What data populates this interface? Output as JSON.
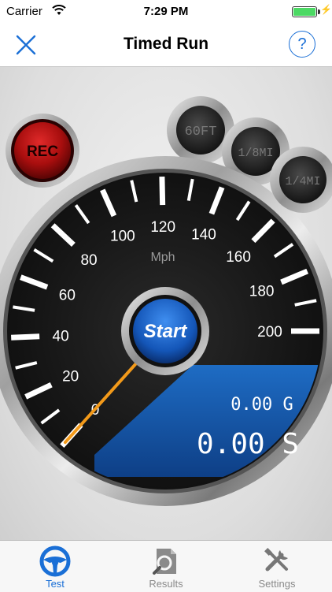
{
  "status": {
    "carrier": "Carrier",
    "time": "7:29 PM"
  },
  "nav": {
    "title": "Timed Run",
    "help": "?"
  },
  "gauge": {
    "unit": "Mph",
    "ticks": [
      "0",
      "20",
      "40",
      "60",
      "80",
      "100",
      "120",
      "140",
      "160",
      "180",
      "200"
    ],
    "needle_mph": 0,
    "start_label": "Start",
    "g_value": "0.00 G",
    "time_value": "0.00 S"
  },
  "buttons": {
    "rec": "REC",
    "b60ft": "60FT",
    "b18mi": "1/8MI",
    "b14mi": "1/4MI"
  },
  "tabs": [
    {
      "label": "Test",
      "active": true
    },
    {
      "label": "Results",
      "active": false
    },
    {
      "label": "Settings",
      "active": false
    }
  ],
  "colors": {
    "accent": "#1a6fd6",
    "needle": "#f39a1a",
    "panel": "#1558a8",
    "rec": "#b31414"
  }
}
